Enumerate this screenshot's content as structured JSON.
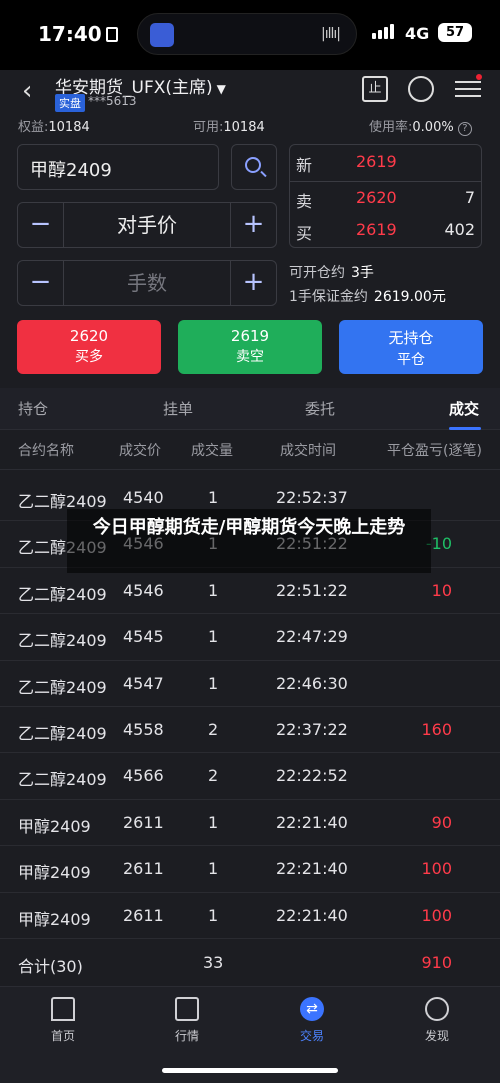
{
  "status_bar": {
    "time": "17:40",
    "network": "4G",
    "battery": "57"
  },
  "header": {
    "account_name": "华安期货_UFX(主席)",
    "account_badge": "实盘",
    "account_no": "***5613",
    "open_icon_label": "止"
  },
  "balance": {
    "equity_label": "权益:",
    "equity": "10184",
    "available_label": "可用:",
    "available": "10184",
    "usage_label": "使用率:",
    "usage": "0.00%"
  },
  "order": {
    "symbol": "甲醇2409",
    "price_mode": "对手价",
    "qty_placeholder": "手数",
    "minus": "−",
    "plus": "+"
  },
  "quote": {
    "last_label": "新",
    "last": "2619",
    "ask_label": "卖",
    "ask": "2620",
    "ask_vol": "7",
    "bid_label": "买",
    "bid": "2619",
    "bid_vol": "402"
  },
  "info": {
    "can_open_label": "可开仓约",
    "can_open": "3手",
    "margin_label": "1手保证金约",
    "margin": "2619.00元"
  },
  "buttons": {
    "buy": {
      "price": "2620",
      "label": "买多"
    },
    "sell": {
      "price": "2619",
      "label": "卖空"
    },
    "close": {
      "price": "无持仓",
      "label": "平仓"
    }
  },
  "tabs": [
    "持仓",
    "挂单",
    "委托",
    "成交"
  ],
  "table": {
    "headers": [
      "合约名称",
      "成交价",
      "成交量",
      "成交时间",
      "平仓盈亏(逐笔)"
    ],
    "rows": [
      {
        "name": "乙二醇2409",
        "price": "4540",
        "qty": "1",
        "time": "22:52:37",
        "pnl": ""
      },
      {
        "name": "乙二醇2409",
        "price": "4546",
        "qty": "1",
        "time": "22:51:22",
        "pnl": "-10"
      },
      {
        "name": "乙二醇2409",
        "price": "4546",
        "qty": "1",
        "time": "22:51:22",
        "pnl": "10"
      },
      {
        "name": "乙二醇2409",
        "price": "4545",
        "qty": "1",
        "time": "22:47:29",
        "pnl": ""
      },
      {
        "name": "乙二醇2409",
        "price": "4547",
        "qty": "1",
        "time": "22:46:30",
        "pnl": ""
      },
      {
        "name": "乙二醇2409",
        "price": "4558",
        "qty": "2",
        "time": "22:37:22",
        "pnl": "160"
      },
      {
        "name": "乙二醇2409",
        "price": "4566",
        "qty": "2",
        "time": "22:22:52",
        "pnl": ""
      },
      {
        "name": "甲醇2409",
        "price": "2611",
        "qty": "1",
        "time": "22:21:40",
        "pnl": "90"
      },
      {
        "name": "甲醇2409",
        "price": "2611",
        "qty": "1",
        "time": "22:21:40",
        "pnl": "100"
      },
      {
        "name": "甲醇2409",
        "price": "2611",
        "qty": "1",
        "time": "22:21:40",
        "pnl": "100"
      }
    ],
    "total": {
      "label": "合计(30)",
      "qty": "33",
      "pnl": "910"
    }
  },
  "overlay_caption": "今日甲醇期货走/甲醇期货今天晚上走势",
  "nav": [
    "首页",
    "行情",
    "交易",
    "发现"
  ],
  "colors": {
    "buy": "#f03041",
    "sell": "#1fae5a",
    "close": "#3374f1",
    "accent": "#3b74ff"
  }
}
